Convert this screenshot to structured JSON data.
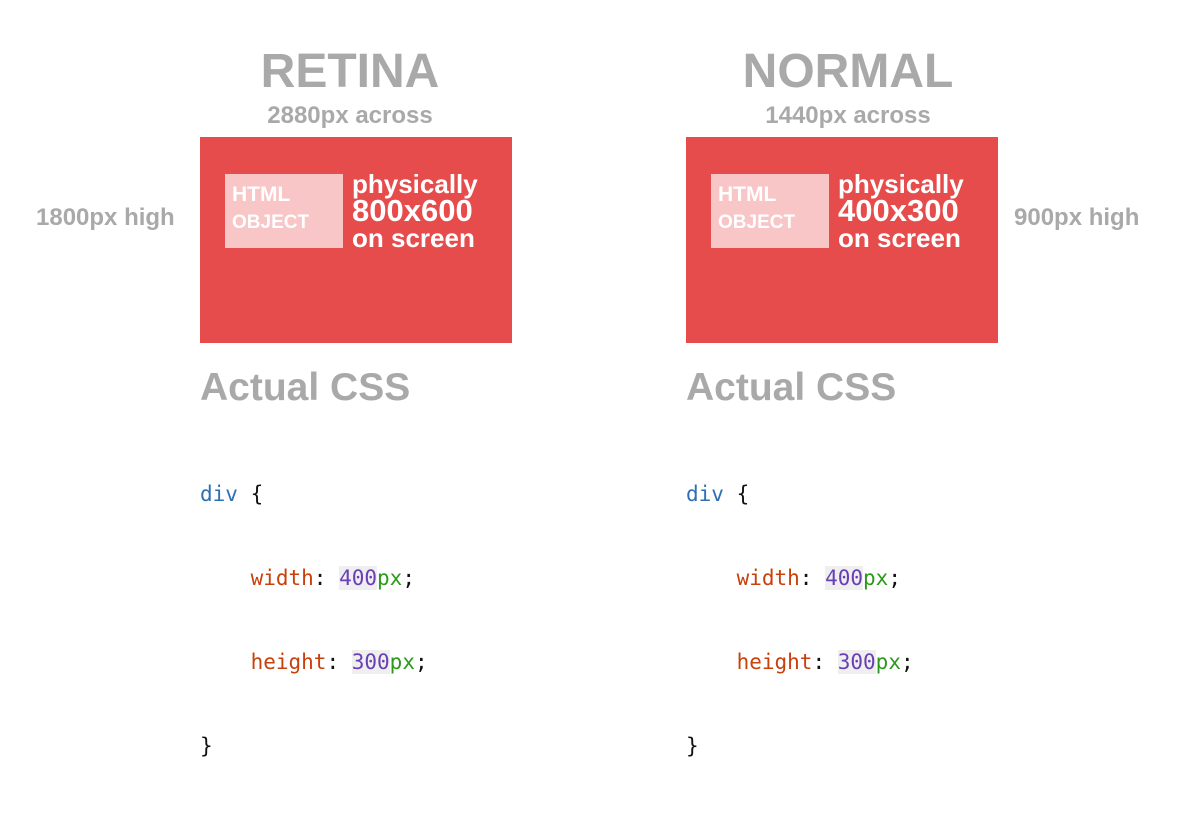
{
  "retina": {
    "title": "RETINA",
    "across": "2880px across",
    "high": "1800px high",
    "object_line1": "HTML",
    "object_line2": "OBJECT",
    "physically": "physically",
    "size": "800x600",
    "on_screen": "on screen",
    "css_heading": "Actual CSS",
    "code": {
      "selector": "div",
      "open_brace": "{",
      "width_prop": "width",
      "width_value": "400",
      "height_prop": "height",
      "height_value": "300",
      "unit": "px",
      "close_brace": "}"
    }
  },
  "normal": {
    "title": "NORMAL",
    "across": "1440px across",
    "high": "900px high",
    "object_line1": "HTML",
    "object_line2": "OBJECT",
    "physically": "physically",
    "size": "400x300",
    "on_screen": "on screen",
    "css_heading": "Actual CSS",
    "code": {
      "selector": "div",
      "open_brace": "{",
      "width_prop": "width",
      "width_value": "400",
      "height_prop": "height",
      "height_value": "300",
      "unit": "px",
      "close_brace": "}"
    }
  },
  "colors": {
    "screen": "#e64c4c",
    "object": "#f8c6c6",
    "label_gray": "#a9a9a9",
    "code_selector": "#2f6fb4",
    "code_property": "#c8410c",
    "code_number": "#6a3fb5",
    "code_unit": "#2a9a19"
  }
}
